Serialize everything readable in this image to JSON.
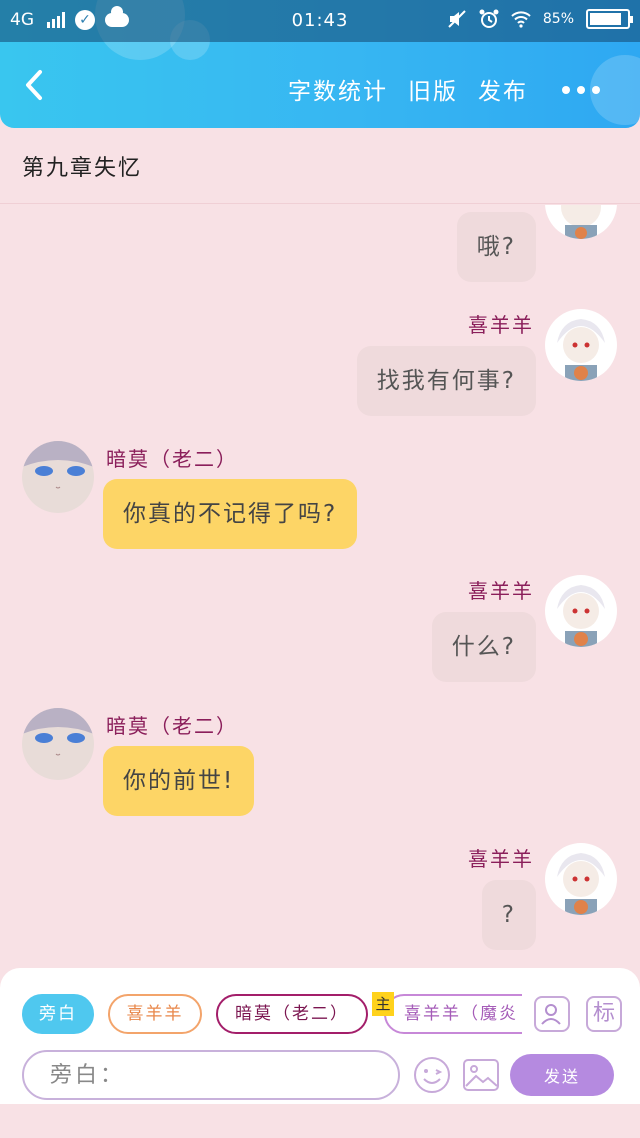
{
  "status_bar": {
    "network": "4G",
    "time": "01:43",
    "battery": "85%",
    "battery_level": 0.85
  },
  "nav": {
    "word_count": "字数统计",
    "old_version": "旧版",
    "publish": "发布"
  },
  "chapter_title": "第九章失忆",
  "messages": [
    {
      "side": "right",
      "name": "",
      "text": "哦?"
    },
    {
      "side": "right",
      "name": "喜羊羊",
      "text": "找我有何事?"
    },
    {
      "side": "left",
      "name": "暗莫（老二）",
      "text": "你真的不记得了吗?"
    },
    {
      "side": "right",
      "name": "喜羊羊",
      "text": "什么?"
    },
    {
      "side": "left",
      "name": "暗莫（老二）",
      "text": "你的前世!"
    },
    {
      "side": "right",
      "name": "喜羊羊",
      "text": "?"
    }
  ],
  "composer": {
    "roles": [
      "旁白",
      "喜羊羊",
      "暗莫（老二）",
      "喜羊羊（魔炎"
    ],
    "main_tag": "主",
    "mark_button": "标",
    "input_placeholder": "旁白：",
    "send_label": "发送"
  },
  "colors": {
    "nav_gradient_start": "#39c6ef",
    "nav_gradient_end": "#2ea8f2",
    "background": "#f8e1e5",
    "right_bubble": "#efdadc",
    "left_bubble": "#fdd566",
    "name_color": "#8a1e5a",
    "send_button": "#b58ae0"
  },
  "icons": [
    "back-arrow-icon",
    "more-dots-icon",
    "check-circle-icon",
    "cloud-icon",
    "mute-icon",
    "alarm-icon",
    "wifi-icon",
    "battery-icon",
    "character-card-icon",
    "emoji-icon",
    "image-icon"
  ]
}
